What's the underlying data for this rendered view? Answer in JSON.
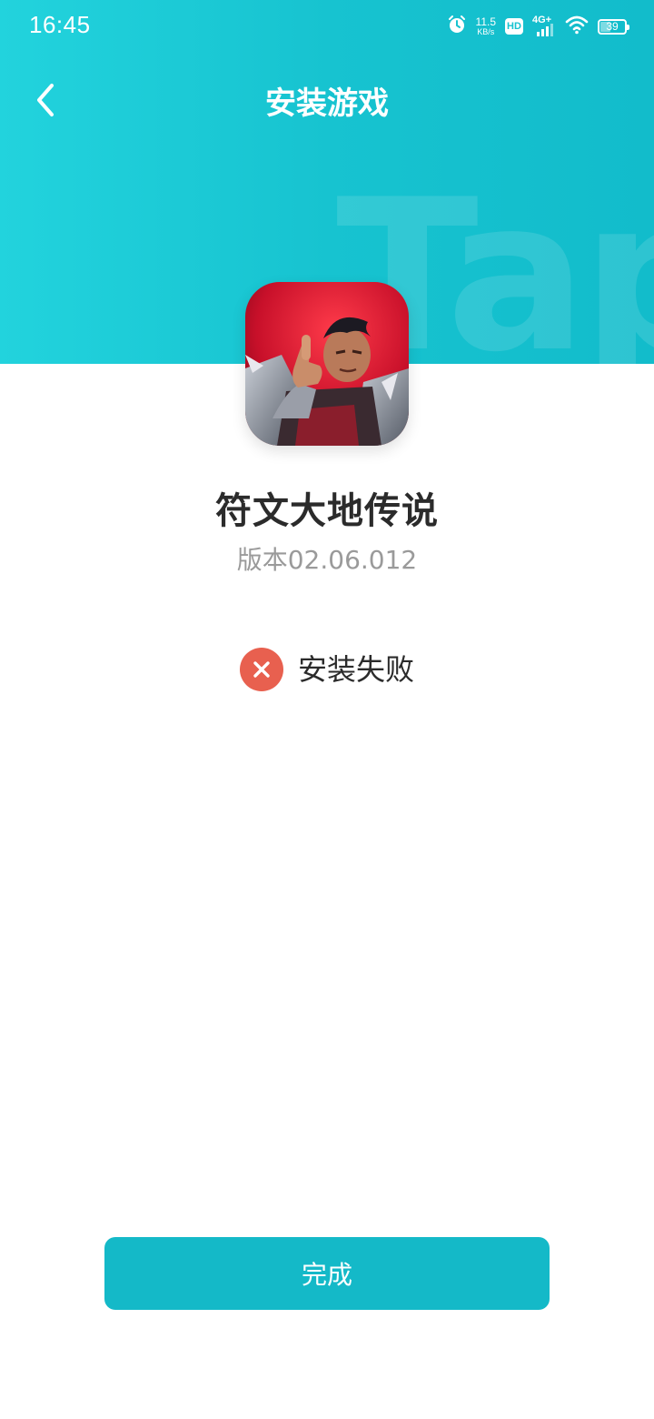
{
  "status_bar": {
    "time": "16:45",
    "net_speed_value": "11.5",
    "net_speed_unit": "KB/s",
    "hd_label": "HD",
    "network_label": "4G+",
    "battery_level": "39"
  },
  "header": {
    "title": "安装游戏",
    "watermark_text": "Tap",
    "background_color": "#17c3d0"
  },
  "app": {
    "name": "符文大地传说",
    "version": "版本02.06.012",
    "icon": "game-hero-icon"
  },
  "install": {
    "status_text": "安装失败",
    "status_icon": "error-x-icon",
    "status_color": "#e8604f"
  },
  "actions": {
    "done_label": "完成",
    "button_color": "#14b9c8"
  }
}
